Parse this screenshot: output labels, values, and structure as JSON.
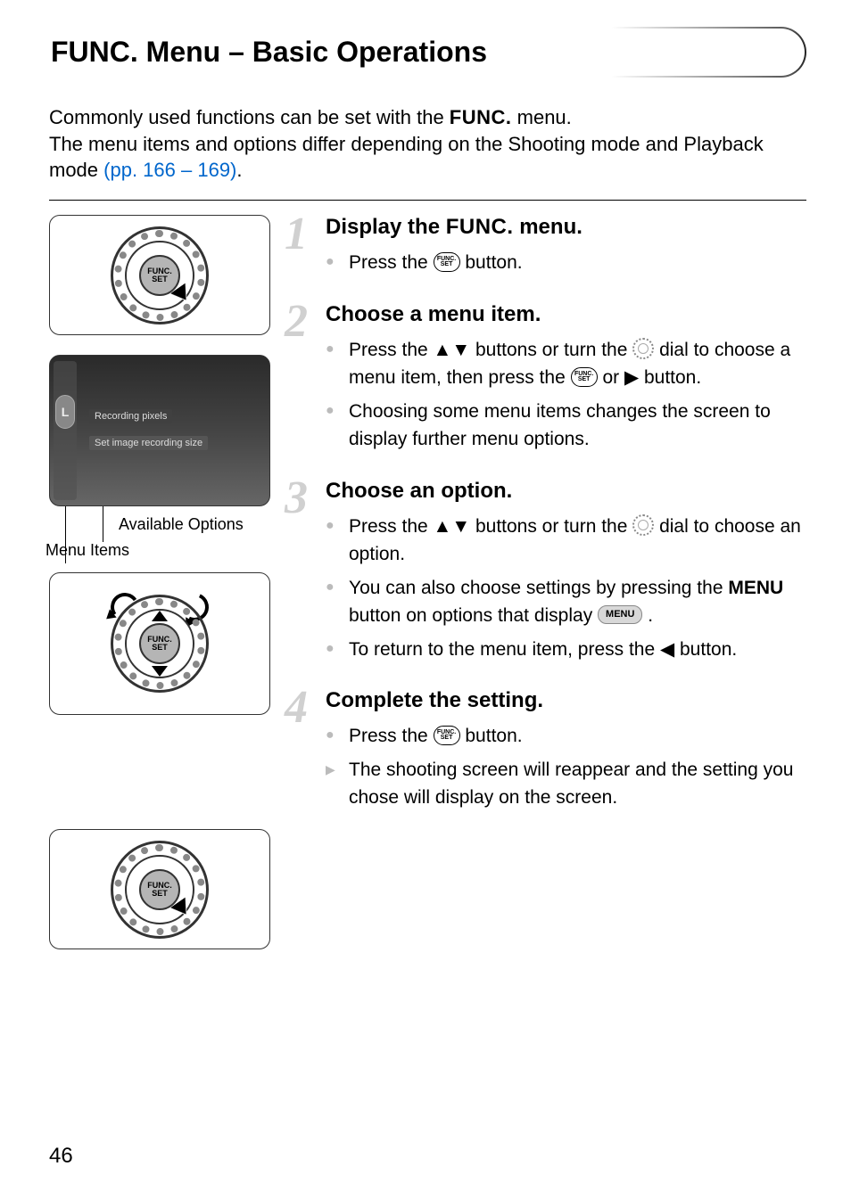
{
  "header": {
    "title": "FUNC. Menu – Basic Operations"
  },
  "intro": {
    "line1_pre": "Commonly used functions can be set with the ",
    "func_label": "FUNC.",
    "line1_post": " menu.",
    "line2": "The menu items and options differ depending on the Shooting mode and Playback mode ",
    "link": "(pp. 166 – 169)",
    "period": "."
  },
  "lcd": {
    "capsule": "L",
    "label1": "Recording pixels",
    "label2": "Set image recording size"
  },
  "captions": {
    "available": "Available Options",
    "menu_items": "Menu Items"
  },
  "steps": [
    {
      "num": "1",
      "title_pre": "Display the ",
      "title_func": "FUNC.",
      "title_post": " menu.",
      "bullets": [
        {
          "type": "dot",
          "parts": [
            "Press the ",
            {
              "icon": "funcset"
            },
            " button."
          ]
        }
      ]
    },
    {
      "num": "2",
      "title": "Choose a menu item.",
      "bullets": [
        {
          "type": "dot",
          "parts": [
            "Press the ",
            {
              "glyph": "▲▼"
            },
            " buttons or turn the ",
            {
              "icon": "dial"
            },
            " dial to choose a menu item, then press the ",
            {
              "icon": "funcset"
            },
            " or ",
            {
              "glyph": "▶"
            },
            " button."
          ]
        },
        {
          "type": "dot",
          "parts": [
            "Choosing some menu items changes the screen to display further menu options."
          ]
        }
      ]
    },
    {
      "num": "3",
      "title": "Choose an option.",
      "bullets": [
        {
          "type": "dot",
          "parts": [
            "Press the ",
            {
              "glyph": "▲▼"
            },
            " buttons or turn the ",
            {
              "icon": "dial"
            },
            " dial to choose an option."
          ]
        },
        {
          "type": "dot",
          "parts": [
            "You can also choose settings by pressing the ",
            {
              "menu_text": "MENU"
            },
            " button on options that display ",
            {
              "menu_badge": "MENU"
            },
            " ."
          ]
        },
        {
          "type": "dot",
          "parts": [
            "To return to the menu item, press the ",
            {
              "glyph": "◀"
            },
            " button."
          ]
        }
      ]
    },
    {
      "num": "4",
      "title": "Complete the setting.",
      "bullets": [
        {
          "type": "dot",
          "parts": [
            "Press the ",
            {
              "icon": "funcset"
            },
            " button."
          ]
        },
        {
          "type": "arrow",
          "parts": [
            "The shooting screen will reappear and the setting you chose will display on the screen."
          ]
        }
      ]
    }
  ],
  "icons": {
    "funcset_top": "FUNC.",
    "funcset_bot": "SET"
  },
  "page_number": "46"
}
